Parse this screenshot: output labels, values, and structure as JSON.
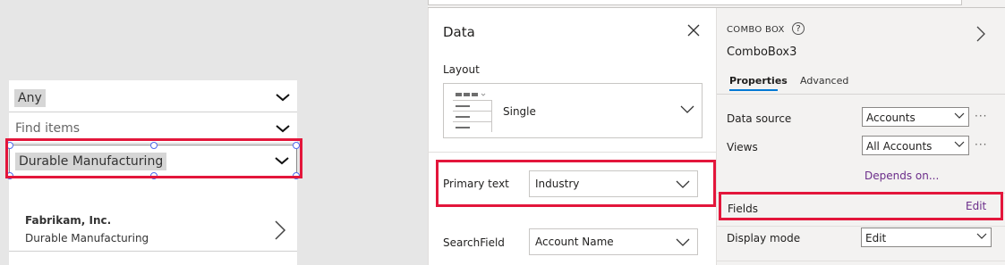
{
  "canvas": {
    "combo1_value": "Any",
    "combo2_placeholder": "Find items",
    "combo3_value": "Durable Manufacturing",
    "gallery_item": {
      "title": "Fabrikam, Inc.",
      "subtitle": "Durable Manufacturing"
    }
  },
  "data_panel": {
    "title": "Data",
    "layout_label": "Layout",
    "layout_value": "Single",
    "primary_text_label": "Primary text",
    "primary_text_value": "Industry",
    "search_field_label": "SearchField",
    "search_field_value": "Account Name"
  },
  "properties": {
    "control_type": "COMBO BOX",
    "control_name": "ComboBox3",
    "tabs": [
      "Properties",
      "Advanced"
    ],
    "data_source_label": "Data source",
    "data_source_value": "Accounts",
    "views_label": "Views",
    "views_value": "All Accounts",
    "depends_on_link": "Depends on...",
    "fields_label": "Fields",
    "fields_edit_link": "Edit",
    "display_mode_label": "Display mode",
    "display_mode_value": "Edit",
    "ellipsis": "···",
    "help_icon_glyph": "?"
  },
  "colors": {
    "highlight_red": "#e3163b",
    "accent_link": "#6b2d8a",
    "tab_underline": "#0078d4"
  }
}
